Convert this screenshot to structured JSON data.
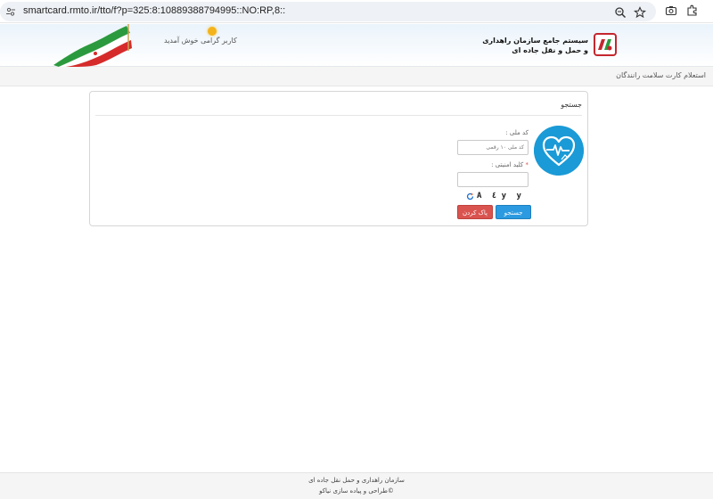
{
  "browser": {
    "url": "smartcard.rmto.ir/tto/f?p=325:8:10889388794995::NO:RP,8::"
  },
  "header": {
    "welcome_text": "کاربر گرامی خوش آمدید",
    "org_title_line1": "سیستم جامع سازمان راهداری",
    "org_title_line2": "و حمل و نقل جاده ای"
  },
  "breadcrumb": {
    "current": "استعلام کارت سلامت رانندگان"
  },
  "search_card": {
    "title": "جستجو",
    "national_code_label": "کد ملی :",
    "national_code_placeholder": "کد ملی ۱۰ رقمی",
    "national_code_value": "",
    "security_key_label": "کلید امنیتی :",
    "security_key_required": "*",
    "security_key_value": "",
    "captcha_text": "A ٤ y y",
    "search_button": "جستجو",
    "clear_button": "پاک کردن"
  },
  "footer": {
    "line1": "سازمان راهداری و حمل نقل جاده ای",
    "line2": "©طراحی و پیاده سازی نیاکو"
  },
  "colors": {
    "accent_blue": "#2b9ae0",
    "danger_red": "#d9534f",
    "heart_badge": "#1a9ad6"
  }
}
